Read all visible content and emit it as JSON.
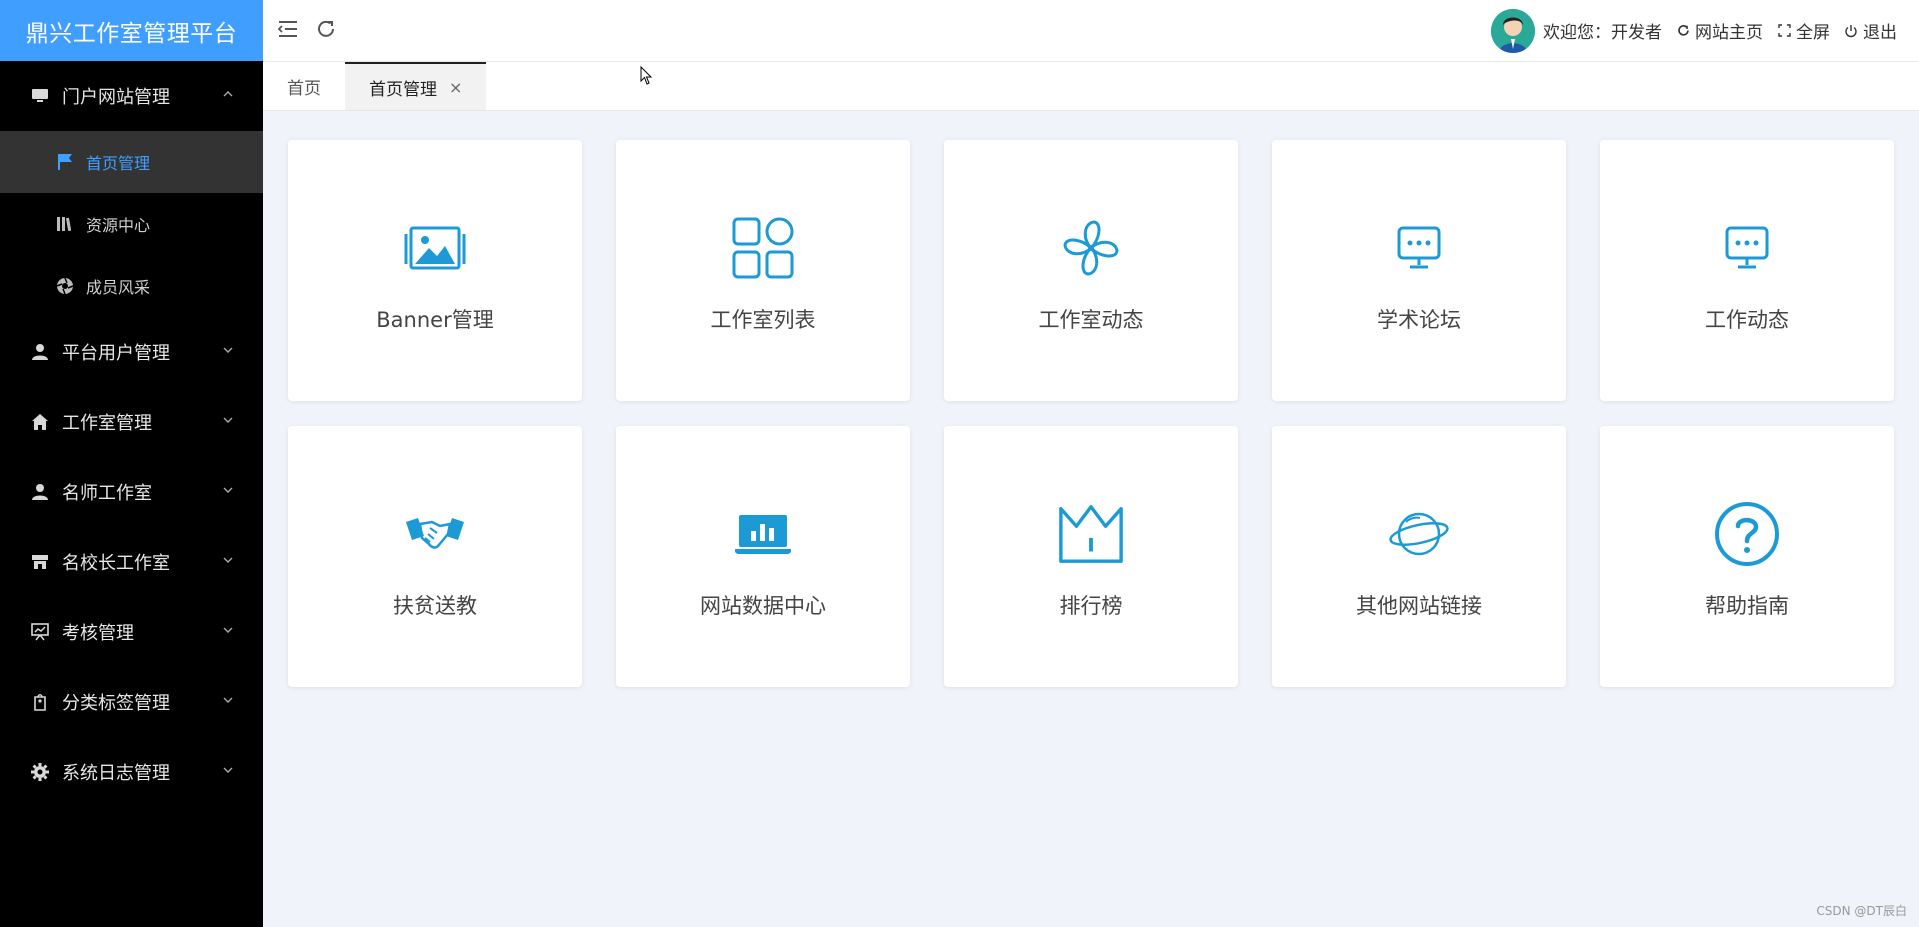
{
  "app": {
    "title": "鼎兴工作室管理平台"
  },
  "colors": {
    "accent": "#409eff",
    "icon_blue": "#1b9ad6",
    "sidebar_bg": "#000000"
  },
  "sidebar": {
    "groups": [
      {
        "label": "门户网站管理",
        "icon": "monitor-icon",
        "expanded": true,
        "children": [
          {
            "label": "首页管理",
            "icon": "flag-icon",
            "active": true
          },
          {
            "label": "资源中心",
            "icon": "library-icon"
          },
          {
            "label": "成员风采",
            "icon": "aperture-icon"
          }
        ]
      },
      {
        "label": "平台用户管理",
        "icon": "user-icon"
      },
      {
        "label": "工作室管理",
        "icon": "home-icon"
      },
      {
        "label": "名师工作室",
        "icon": "user-icon"
      },
      {
        "label": "名校长工作室",
        "icon": "store-icon"
      },
      {
        "label": "考核管理",
        "icon": "presentation-icon"
      },
      {
        "label": "分类标签管理",
        "icon": "tag-icon"
      },
      {
        "label": "系统日志管理",
        "icon": "gear-icon"
      }
    ]
  },
  "header": {
    "welcome": "欢迎您：开发者",
    "links": [
      {
        "label": "网站主页",
        "icon": "refresh-link-icon"
      },
      {
        "label": "全屏",
        "icon": "fullscreen-icon"
      },
      {
        "label": "退出",
        "icon": "power-icon"
      }
    ]
  },
  "tabs": [
    {
      "label": "首页",
      "active": false,
      "closable": false
    },
    {
      "label": "首页管理",
      "active": true,
      "closable": true,
      "close_glyph": "×"
    }
  ],
  "cards": [
    {
      "label": "Banner管理",
      "icon": "image-icon"
    },
    {
      "label": "工作室列表",
      "icon": "grid-icon"
    },
    {
      "label": "工作室动态",
      "icon": "fan-icon"
    },
    {
      "label": "学术论坛",
      "icon": "monitor-chat-icon"
    },
    {
      "label": "工作动态",
      "icon": "monitor-chat-icon"
    },
    {
      "label": "扶贫送教",
      "icon": "handshake-icon"
    },
    {
      "label": "网站数据中心",
      "icon": "laptop-chart-icon"
    },
    {
      "label": "排行榜",
      "icon": "crown-icon"
    },
    {
      "label": "其他网站链接",
      "icon": "planet-icon"
    },
    {
      "label": "帮助指南",
      "icon": "help-circle-icon"
    }
  ],
  "watermark": "CSDN @DT辰白"
}
